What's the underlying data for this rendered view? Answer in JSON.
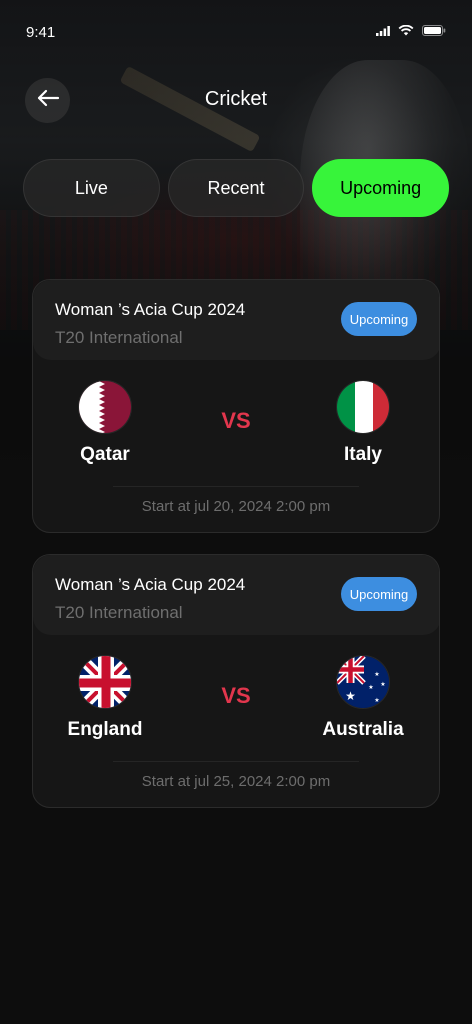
{
  "status_bar": {
    "time": "9:41"
  },
  "header": {
    "title": "Cricket"
  },
  "tabs": [
    {
      "label": "Live",
      "active": false
    },
    {
      "label": "Recent",
      "active": false
    },
    {
      "label": "Upcoming",
      "active": true
    }
  ],
  "matches": [
    {
      "title": "Woman ’s Acia Cup 2024",
      "type": "T20 International",
      "badge": "Upcoming",
      "team1": {
        "name": "Qatar",
        "flag": "qatar-flag-icon"
      },
      "vs": "VS",
      "team2": {
        "name": "Italy",
        "flag": "italy-flag-icon"
      },
      "start": "Start at jul 20, 2024 2:00 pm"
    },
    {
      "title": "Woman ’s Acia Cup 2024",
      "type": "T20 International",
      "badge": "Upcoming",
      "team1": {
        "name": "England",
        "flag": "uk-flag-icon"
      },
      "vs": "VS",
      "team2": {
        "name": "Australia",
        "flag": "australia-flag-icon"
      },
      "start": "Start at jul 25, 2024 2:00 pm"
    }
  ],
  "colors": {
    "accent_green": "#37f43a",
    "badge_blue": "#3d8ee0",
    "vs_red": "#e2364d",
    "background": "#0d0d0d"
  }
}
